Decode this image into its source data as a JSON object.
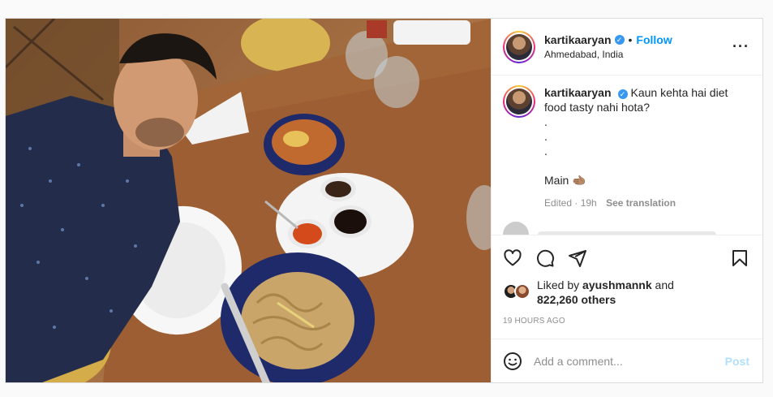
{
  "post": {
    "author": {
      "username": "kartikaaryan",
      "verified_icon": "verified-badge-icon",
      "follow_label": "Follow",
      "location": "Ahmedabad, India"
    },
    "more_icon": "more-options-icon",
    "caption": {
      "username": "kartikaaryan",
      "text": "Kaun kehta hai diet food tasty nahi hota?",
      "lines": [
        ".",
        ".",
        "."
      ],
      "last_line": "Main 🫲🏽",
      "edited": "Edited · 19h",
      "see_translation": "See translation"
    },
    "actions": {
      "like_icon": "heart-icon",
      "comment_icon": "comment-icon",
      "share_icon": "share-icon",
      "save_icon": "bookmark-icon"
    },
    "likes": {
      "prefix": "Liked by",
      "user": "ayushmannk",
      "and": "and",
      "count": "822,260 others"
    },
    "time_ago": "19 HOURS AGO",
    "add_comment": {
      "placeholder": "Add a comment...",
      "post_label": "Post",
      "emoji_icon": "emoji-icon"
    }
  },
  "colors": {
    "link_blue": "#0095f6",
    "post_disabled": "#b2dffc",
    "muted": "#8e8e8e",
    "text": "#262626"
  }
}
